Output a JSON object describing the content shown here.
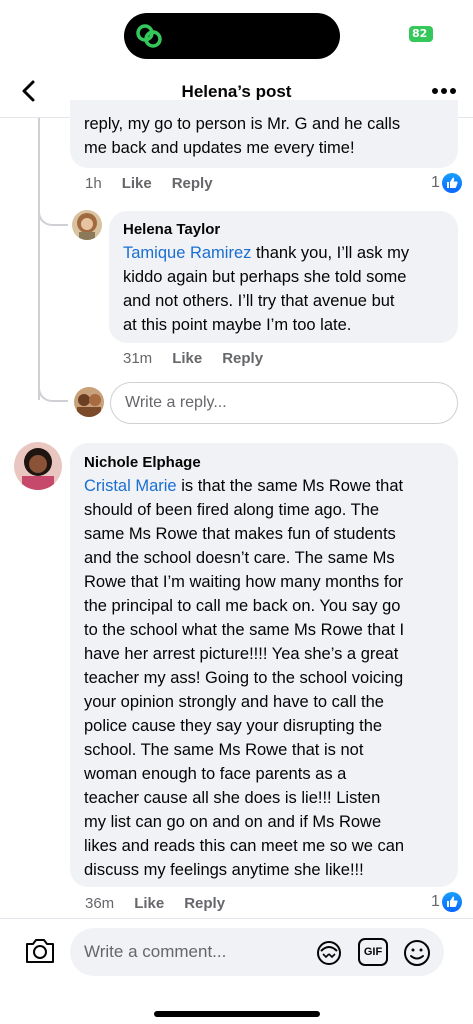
{
  "status_bar": {
    "battery": "82"
  },
  "header": {
    "title": "Helena’s post"
  },
  "comments": [
    {
      "text_lines": [
        "reply, my go to person is Mr. G and he calls",
        "me back and updates me every time!"
      ],
      "time": "1h",
      "like_label": "Like",
      "reply_label": "Reply",
      "reactions": "1"
    },
    {
      "author": "Helena Taylor",
      "mention": "Tamique Ramirez",
      "first_line_rest": " thank you, I’ll ask my",
      "text_lines": [
        "kiddo again but perhaps she told some",
        "and not others. I’ll try that avenue but",
        "at this point maybe I’m too late."
      ],
      "time": "31m",
      "like_label": "Like",
      "reply_label": "Reply"
    },
    {
      "author": "Nichole Elphage",
      "mention": "Cristal Marie",
      "first_line_rest": " is that the same Ms Rowe that",
      "text_lines": [
        "should of been fired along time ago. The",
        "same Ms Rowe that makes fun of students",
        "and the school doesn’t care. The same Ms",
        "Rowe that I’m waiting how many months for",
        "the principal to call me back on. You say go",
        "to the school what the same Ms Rowe that I",
        "have her arrest picture!!!! Yea she’s a great",
        "teacher my ass! Going to the school voicing",
        "your opinion strongly and have to call the",
        "police cause they say your disrupting the",
        "school. The same Ms Rowe that is not",
        "woman enough to face parents as a",
        "teacher cause all she does is lie!!! Listen",
        "my list can go on and on and if Ms Rowe",
        "likes and reads this can meet me so we can",
        "discuss my feelings anytime she like!!!"
      ],
      "time": "36m",
      "like_label": "Like",
      "reply_label": "Reply",
      "reactions": "1"
    }
  ],
  "reply_box": {
    "placeholder": "Write a reply..."
  },
  "composer": {
    "placeholder": "Write a comment...",
    "gif_label": "GIF"
  },
  "colors": {
    "mention": "#1a6fd1",
    "like_blue": "#0866ff",
    "bubble": "#f0f2f5",
    "meta": "#65676b"
  }
}
